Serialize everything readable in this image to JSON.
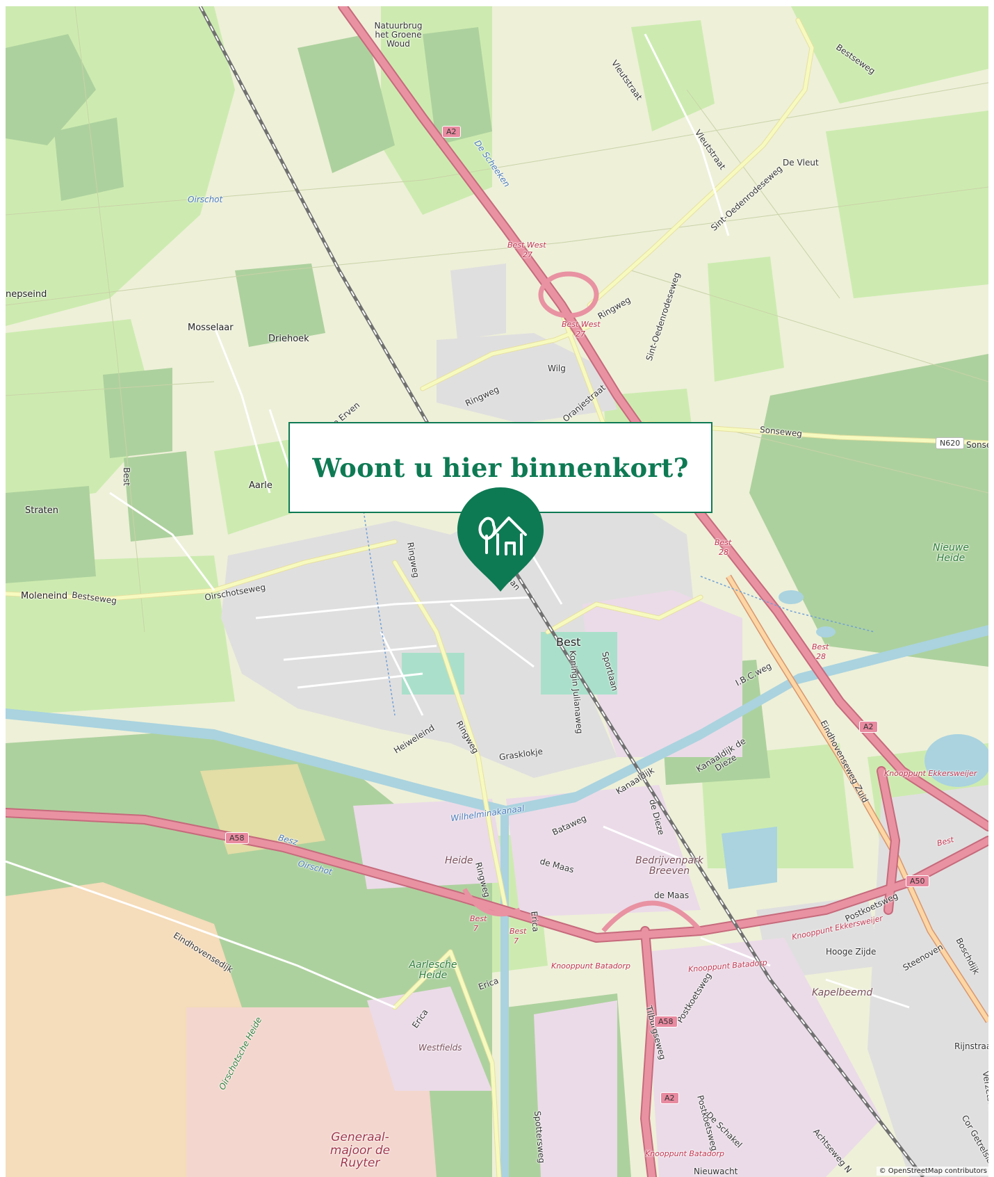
{
  "banner": {
    "title": "Woont u hier binnenkort?"
  },
  "marker": {
    "icon": "tree-house-icon",
    "color": "#0e7a54"
  },
  "attribution": "© OpenStreetMap contributors",
  "map": {
    "colors": {
      "background": "#eef0d8",
      "farmland": "#e9f2c8",
      "meadow": "#cdebb0",
      "forest": "#add19e",
      "residential": "#e0dfdf",
      "industrial": "#ebdbe8",
      "water": "#aad3df",
      "motorway": "#e892a2",
      "trunk": "#f9b29c",
      "secondary": "#f7fabf",
      "heath": "#f5dcba",
      "railway": "#707070"
    },
    "labels": {
      "natuurbrug": "Natuurbrug het Groene Woud",
      "a2_top": "A2",
      "de_scheeken": "De Scheeken",
      "oirschot_top": "Oirschot",
      "best_west_1": "Best West",
      "exit_27_1": "27",
      "best_west_2": "Best West",
      "exit_27_2": "27",
      "vleutstraat_1": "Vleutstraat",
      "vleutstraat_2": "Vleutstraat",
      "bestseweg_top": "Bestseweg",
      "de_vleut": "De Vleut",
      "sint_oedenrodeseweg_1": "Sint-Oedenrodeseweg",
      "sint_oedenrodeseweg_2": "Sint-Oedenrodeseweg",
      "ringweg_ne": "Ringweg",
      "wilg": "Wilg",
      "ringweg_nw": "Ringweg",
      "oranjestraat": "Oranjestraat",
      "mosselaar": "Mosselaar",
      "driehoek": "Driehoek",
      "nepseind": "nepseind",
      "erven": "che Erven",
      "best_road": "Best",
      "aarle": "Aarle",
      "straten": "Straten",
      "sonseweg": "Sonseweg",
      "n620": "N620",
      "sonseweg_2": "Sonseweg",
      "best_28_1": "Best",
      "exit_28_1": "28",
      "nieuwe_heide": "Nieuwe Heide",
      "moleneind": "Moleneind",
      "bestseweg_w": "Bestseweg",
      "oirschotseweg": "Oirschotseweg",
      "ringweg_w": "Ringweg",
      "bernardlaan": "rnardlaan",
      "best_town": "Best",
      "sportlaan": "Sportlaan",
      "koningin_julianaweg": "Koningin Julianaweg",
      "ibc_weg": "I.B.C.weg",
      "best_28_2": "Best",
      "exit_28_2": "28",
      "heiweleind": "Heiweleind",
      "ringweg_s": "Ringweg",
      "grasklokje": "Grasklokje",
      "kanaaldijk_de_dieze": "Kanaaldijk de Dieze",
      "eindhovenseweg_zuid": "Eindhovenseweg Zuid",
      "a2_e": "A2",
      "knooppunt_ekkersweijer_1": "Knooppunt Ekkersweijer",
      "kanaaldijk": "Kanaaldijk",
      "a58_w": "A58",
      "besz": "Besz",
      "oirschot_s": "Oirschot",
      "wilhelminakanaal": "Wilhelminakanaal",
      "bataweg": "Bataweg",
      "de_dieze": "de Dieze",
      "heide": "Heide",
      "de_maas_1": "de Maas",
      "bedrijvenpark_breeven": "Bedrijvenpark Breeven",
      "ringweg_sw": "Ringweg",
      "best_7_1": "Best",
      "exit_7_1": "7",
      "best_7_2": "Best",
      "exit_7_2": "7",
      "erica_1": "Erica",
      "de_maas_2": "de Maas",
      "a50": "A50",
      "best_e": "Best",
      "postkoetsweg_1": "Postkoetsweg",
      "knooppunt_ekkersweijer_2": "Knooppunt Ekkersweijer",
      "boschdijk": "Boschdijk",
      "eindhovensedijk": "Eindhovensedijk",
      "aarlesche_heide": "Aarlesche Heide",
      "knooppunt_batadorp_1": "Knooppunt Batadorp",
      "knooppunt_batadorp_2": "Knooppunt Batadorp",
      "hooge_zijde": "Hooge Zijde",
      "steenoven": "Steenoven",
      "kapelbeemd": "Kapelbeemd",
      "erica_2": "Erica",
      "erica_3": "Erica",
      "postkoetsweg_2": "Postkoetsweg",
      "tilburgseweg": "Tilburgseweg",
      "a58_s": "A58",
      "oirschotsche_heide": "Oirschotsche Heide",
      "westfields": "Westfields",
      "rijnstraat": "Rijnstraat",
      "a2_s": "A2",
      "postkoetsweg_3": "Postkoetsweg",
      "de_schakel": "De Schakel",
      "verzetsheld": "Verzetsheld",
      "generaal_majoor": "Generaal-majoor de Ruyter",
      "spottersweg": "Spottersweg",
      "knooppunt_batadorp_3": "Knooppunt Batadorp",
      "nieuwacht": "Nieuwacht",
      "achtseweg": "Achtseweg N",
      "cor_getrelsplaats": "Cor Getrelslaan"
    }
  }
}
